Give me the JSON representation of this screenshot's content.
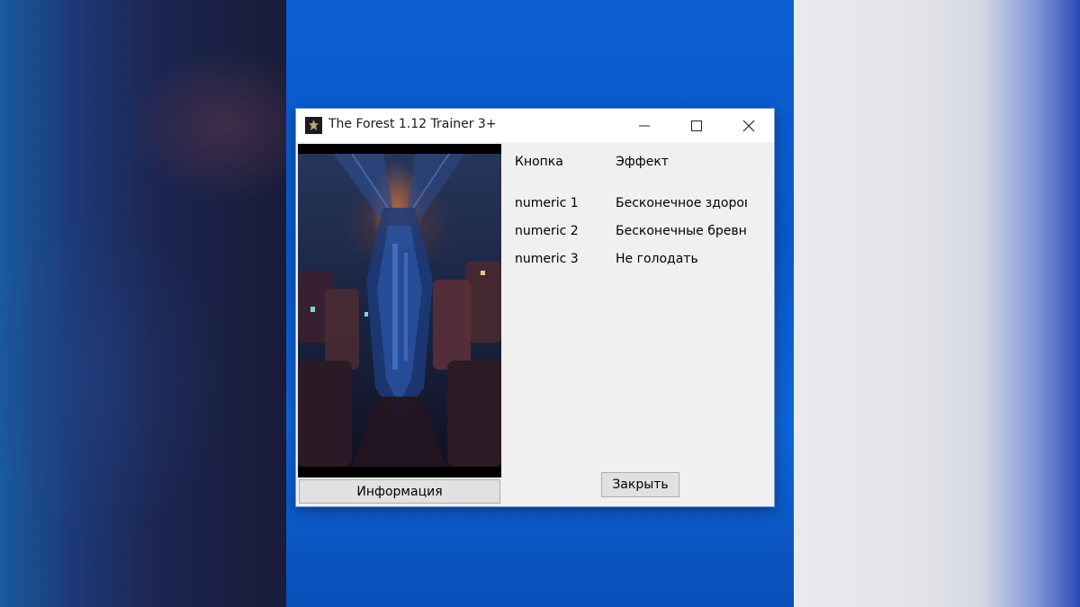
{
  "window": {
    "title": "The Forest 1.12 Trainer 3+",
    "controls": {
      "minimize_icon": "minimize-icon",
      "maximize_icon": "maximize-icon",
      "close_icon": "close-icon"
    }
  },
  "hotkeys_table": {
    "header_key": "Кнопка",
    "header_effect": "Эффект",
    "rows": [
      {
        "key": "numeric 1",
        "effect": "Бесконечное здоровье"
      },
      {
        "key": "numeric 2",
        "effect": "Бесконечные бревна"
      },
      {
        "key": "numeric 3",
        "effect": "Не голодать"
      }
    ]
  },
  "buttons": {
    "info_label": "Информация",
    "close_label": "Закрыть"
  },
  "colors": {
    "window_bg": "#f0f0f0",
    "button_bg": "#e1e1e1",
    "desktop_blue": "#0b5fd0"
  }
}
